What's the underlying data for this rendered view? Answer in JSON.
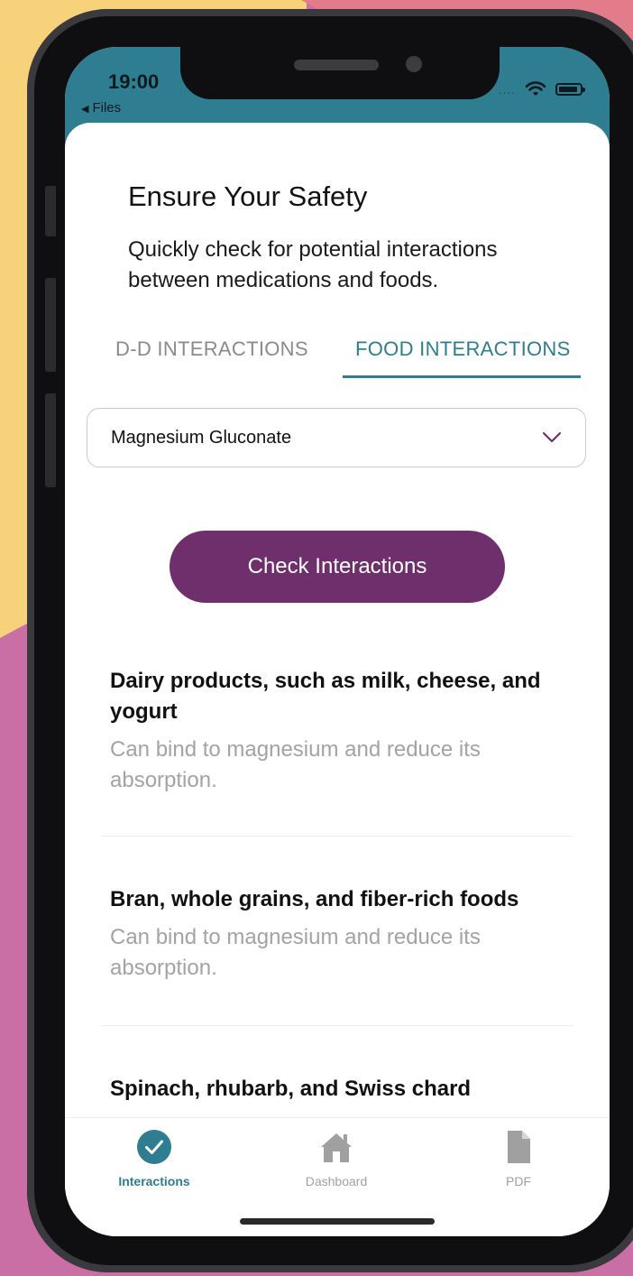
{
  "status_bar": {
    "time": "19:00",
    "back_label": "Files",
    "signal_dots": "....",
    "wifi_icon": "wifi-icon",
    "battery_icon": "battery-icon"
  },
  "header": {
    "title": "Ensure Your Safety",
    "subtitle": "Quickly check for potential interactions between medications and foods."
  },
  "tabs": [
    {
      "label": "D-D INTERACTIONS",
      "active": false
    },
    {
      "label": "FOOD INTERACTIONS",
      "active": true
    }
  ],
  "medication_select": {
    "selected": "Magnesium Gluconate",
    "icon": "chevron-down-icon"
  },
  "check_button": {
    "label": "Check Interactions"
  },
  "results": [
    {
      "food": "Dairy products, such as milk, cheese, and yogurt",
      "description": "Can bind to magnesium and reduce its absorption."
    },
    {
      "food": "Bran, whole grains, and fiber-rich foods",
      "description": "Can bind to magnesium and reduce its absorption."
    },
    {
      "food": "Spinach, rhubarb, and Swiss chard",
      "description": ""
    }
  ],
  "tab_bar": [
    {
      "label": "Interactions",
      "icon": "check-circle-icon",
      "active": true
    },
    {
      "label": "Dashboard",
      "icon": "home-icon",
      "active": false
    },
    {
      "label": "PDF",
      "icon": "document-icon",
      "active": false
    }
  ],
  "colors": {
    "accent": "#2f7d90",
    "button": "#6f2f6d",
    "muted_text": "#a3a3a3"
  }
}
